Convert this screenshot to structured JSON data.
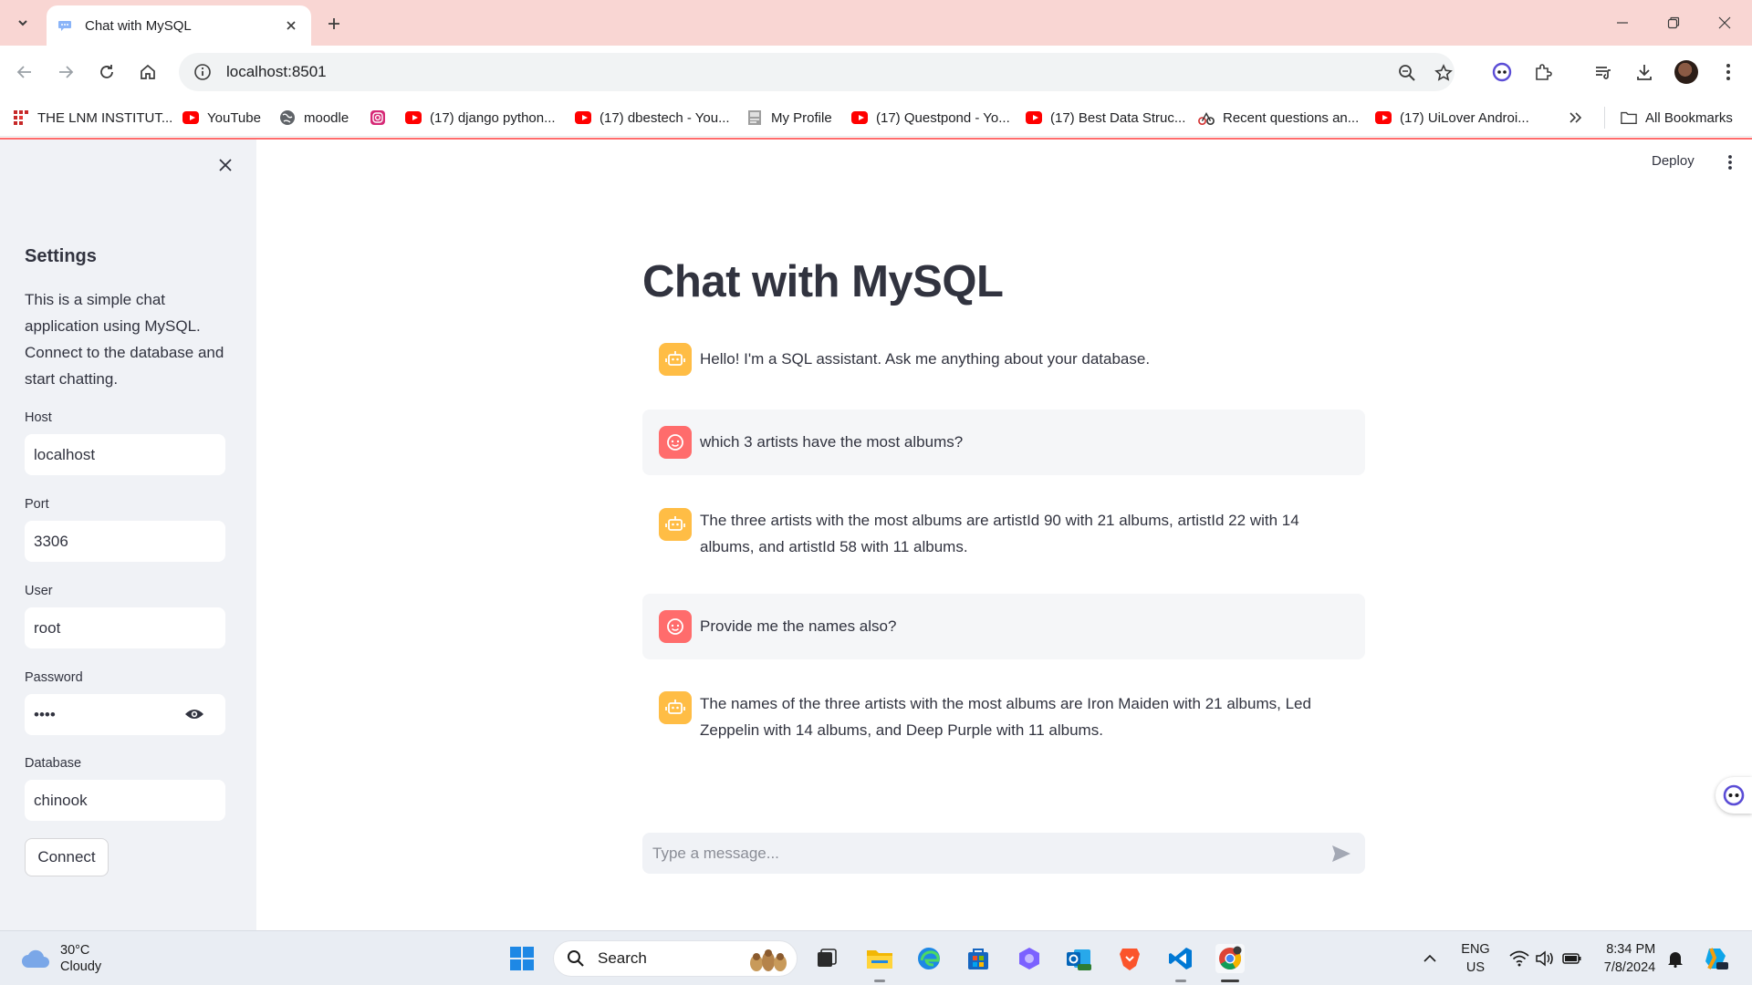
{
  "browser": {
    "tab_title": "Chat with MySQL",
    "url": "localhost:8501"
  },
  "bookmarks": [
    {
      "label": "THE LNM INSTITUT...",
      "icon": "lnm-logo-icon"
    },
    {
      "label": "YouTube",
      "icon": "youtube-icon"
    },
    {
      "label": "moodle",
      "icon": "globe-icon"
    },
    {
      "label": "",
      "icon": "instagram-icon"
    },
    {
      "label": "(17) django python...",
      "icon": "youtube-icon"
    },
    {
      "label": "(17) dbestech - You...",
      "icon": "youtube-icon"
    },
    {
      "label": "My Profile",
      "icon": "profile-page-icon"
    },
    {
      "label": "(17) Questpond - Yo...",
      "icon": "youtube-icon"
    },
    {
      "label": "(17) Best Data Struc...",
      "icon": "youtube-icon"
    },
    {
      "label": "Recent questions an...",
      "icon": "qa-site-icon"
    },
    {
      "label": "(17) UiLover Androi...",
      "icon": "youtube-icon"
    }
  ],
  "all_bookmarks_label": "All Bookmarks",
  "sidebar": {
    "title": "Settings",
    "description": "This is a simple chat application using MySQL. Connect to the database and start chatting.",
    "fields": {
      "host": {
        "label": "Host",
        "value": "localhost"
      },
      "port": {
        "label": "Port",
        "value": "3306"
      },
      "user": {
        "label": "User",
        "value": "root"
      },
      "password": {
        "label": "Password",
        "value": "••••"
      },
      "database": {
        "label": "Database",
        "value": "chinook"
      }
    },
    "connect_label": "Connect"
  },
  "header": {
    "deploy_label": "Deploy"
  },
  "main": {
    "title": "Chat with MySQL",
    "messages": [
      {
        "role": "assistant",
        "text": "Hello! I'm a SQL assistant. Ask me anything about your database."
      },
      {
        "role": "user",
        "text": "which 3 artists have the most albums?"
      },
      {
        "role": "assistant",
        "text": "The three artists with the most albums are artistId 90 with 21 albums, artistId 22 with 14 albums, and artistId 58 with 11 albums."
      },
      {
        "role": "user",
        "text": "Provide me the names also?"
      },
      {
        "role": "assistant",
        "text": "The names of the three artists with the most albums are Iron Maiden with 21 albums, Led Zeppelin with 14 albums, and Deep Purple with 11 albums."
      }
    ],
    "input_placeholder": "Type a message..."
  },
  "taskbar": {
    "weather_temp": "30°C",
    "weather_desc": "Cloudy",
    "search_label": "Search",
    "lang_top": "ENG",
    "lang_bottom": "US",
    "time": "8:34 PM",
    "date": "7/8/2024"
  },
  "colors": {
    "accent_red": "#ff4b4b",
    "assistant_avatar": "#ffbd45",
    "user_avatar": "#ff6c6c",
    "sidebar_bg": "#f0f2f6"
  }
}
